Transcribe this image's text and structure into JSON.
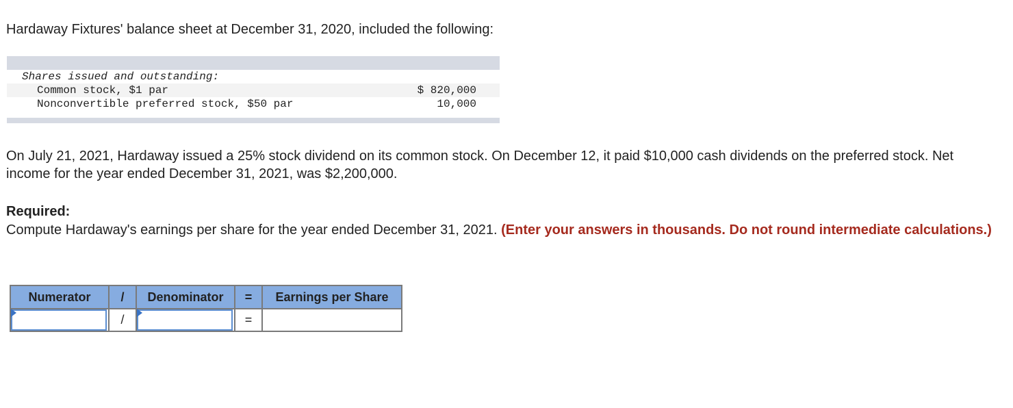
{
  "intro": "Hardaway Fixtures' balance sheet at December 31, 2020, included the following:",
  "balance_sheet": {
    "heading": "Shares issued and outstanding:",
    "rows": [
      {
        "label": "Common stock, $1 par",
        "value": "$ 820,000"
      },
      {
        "label": "Nonconvertible preferred stock, $50 par",
        "value": "10,000"
      }
    ]
  },
  "paragraph": "On July 21, 2021, Hardaway issued a 25% stock dividend on its common stock. On December 12, it paid $10,000 cash dividends on the preferred stock. Net income for the year ended December 31, 2021, was $2,200,000.",
  "required": {
    "heading": "Required:",
    "text": "Compute Hardaway's earnings per share for the year ended December 31, 2021.",
    "instruction": "(Enter your answers in thousands. Do not round intermediate calculations.)"
  },
  "eps_table": {
    "headers": [
      "Numerator",
      "/",
      "Denominator",
      "=",
      "Earnings per Share"
    ],
    "row": {
      "numerator": "",
      "slash": "/",
      "denominator": "",
      "equals": "=",
      "eps": ""
    }
  }
}
